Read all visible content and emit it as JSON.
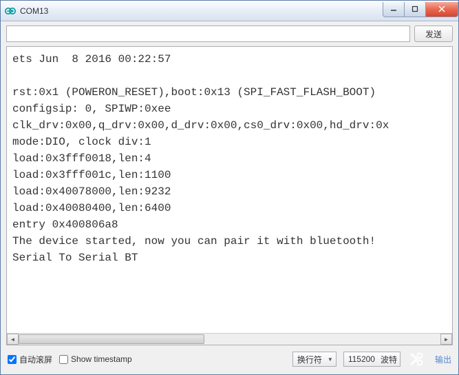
{
  "window": {
    "title": "COM13"
  },
  "inputRow": {
    "sendInput": "",
    "sendLabel": "发送"
  },
  "output": {
    "text": "ets Jun  8 2016 00:22:57\n\nrst:0x1 (POWERON_RESET),boot:0x13 (SPI_FAST_FLASH_BOOT)\nconfigsip: 0, SPIWP:0xee\nclk_drv:0x00,q_drv:0x00,d_drv:0x00,cs0_drv:0x00,hd_drv:0x\nmode:DIO, clock div:1\nload:0x3fff0018,len:4\nload:0x3fff001c,len:1100\nload:0x40078000,len:9232\nload:0x40080400,len:6400\nentry 0x400806a8\nThe device started, now you can pair it with bluetooth!\nSerial To Serial BT\n"
  },
  "bottomBar": {
    "autoscroll": {
      "checked": true,
      "label": "自动滚屏"
    },
    "showTimestamp": {
      "checked": false,
      "label": "Show timestamp"
    },
    "lineEnding": {
      "selected": "换行符"
    },
    "baud": {
      "selected": "115200",
      "label": "波特"
    },
    "clearSuffix": "输出"
  }
}
